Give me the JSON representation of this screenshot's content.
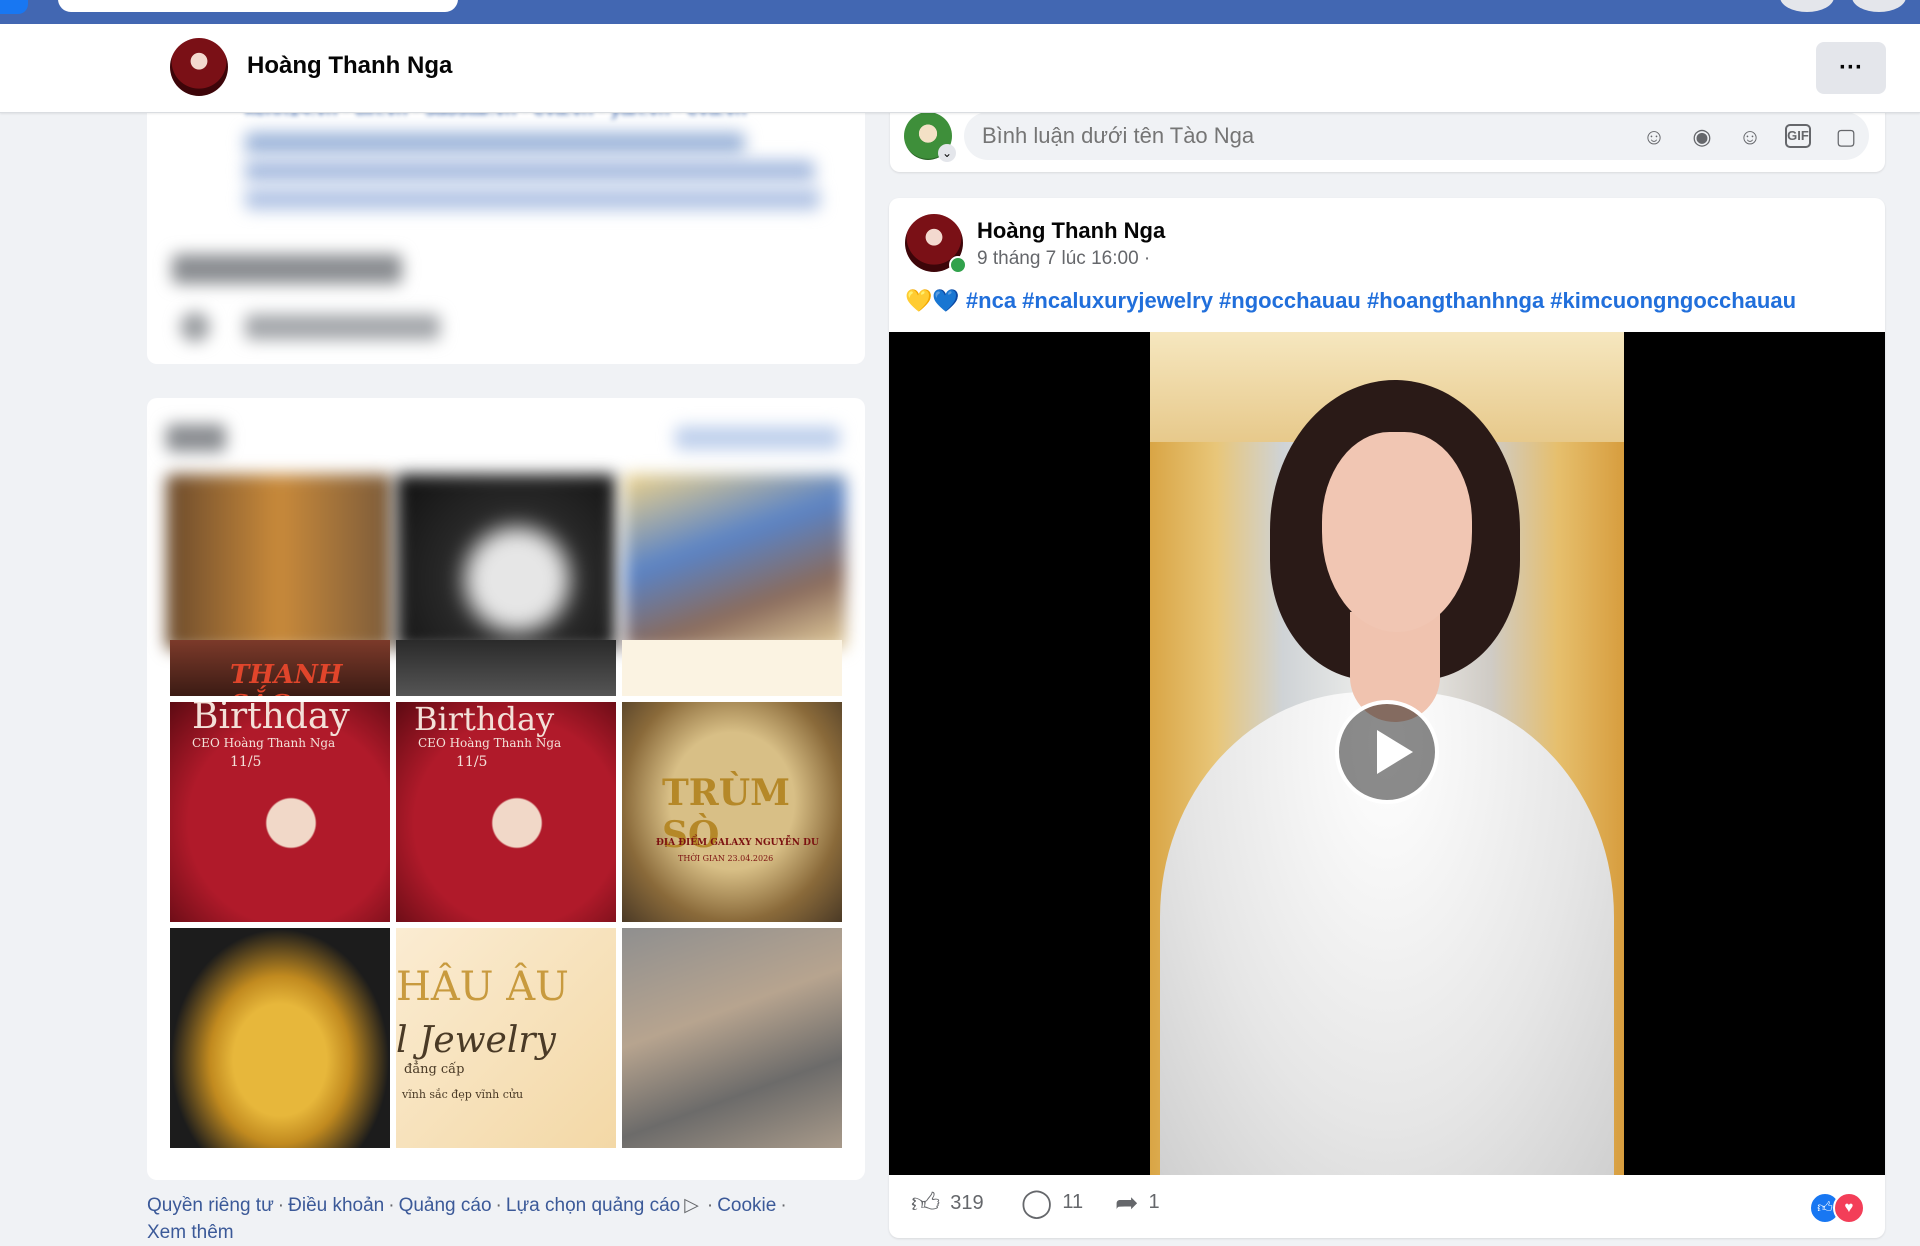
{
  "header": {
    "profile_name": "Hoàng Thanh Nga",
    "more_label": "···"
  },
  "left": {
    "source_strip": "kenh14.vn · tiin.vn · saostar.vn · eva.vn · yan.vn · eva.vn",
    "grid_captions": {
      "top_left": "THANH SẮC",
      "birthday_title": "Birthday",
      "birthday_sub": "CEO Hoàng Thanh Nga",
      "birthday_date": "11/5",
      "event_title": "TRÙM SÒ",
      "event_place": "ĐỊA ĐIỂM GALAXY NGUYỄN DU",
      "event_date": "THỜI GIAN 23.04.2026",
      "jewelry_brand": "HÂU ÂU",
      "jewelry_script": "l Jewelry",
      "jewelry_line1": "đẳng cấp",
      "jewelry_line2": "vĩnh sắc đẹp vĩnh cửu"
    }
  },
  "footer": {
    "links": [
      "Quyền riêng tư",
      "Điều khoản",
      "Quảng cáo",
      "Lựa chọn quảng cáo",
      "Cookie"
    ],
    "see_more": "Xem thêm"
  },
  "comment_box": {
    "placeholder": "Bình luận dưới tên Tào Nga",
    "icons": [
      "avatar-sticker-icon",
      "emoji-face-icon",
      "smile-icon",
      "gif-icon",
      "sticker-icon"
    ]
  },
  "post": {
    "author": "Hoàng Thanh Nga",
    "time": "9 tháng 7 lúc 16:00 ·",
    "emojis": "💛💙",
    "hashtags": "#nca #ncaluxuryjewelry #ngocchauau #hoangthanhnga #kimcuongngocchauau",
    "likes": "319",
    "comments": "11",
    "shares": "1"
  },
  "colors": {
    "topbar": "#4267b2",
    "link": "#216fdb",
    "background": "#f0f2f5"
  }
}
